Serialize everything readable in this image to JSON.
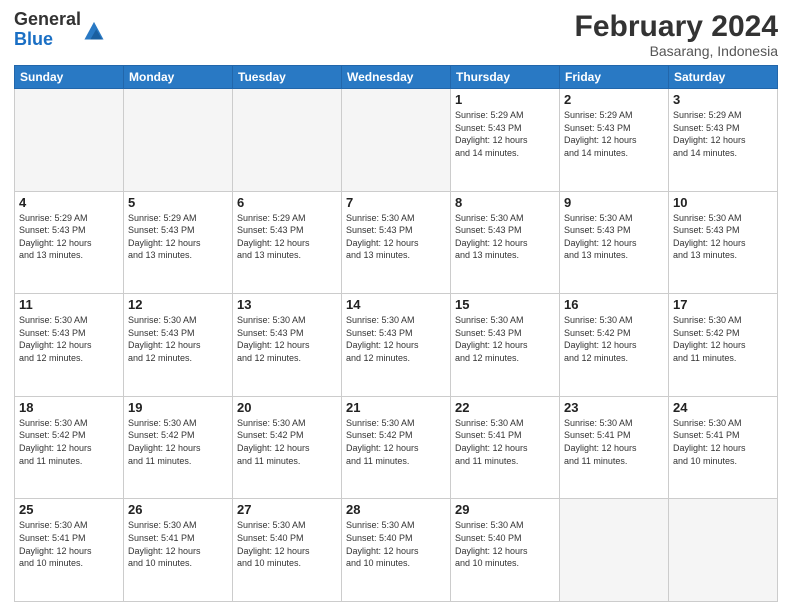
{
  "header": {
    "logo_general": "General",
    "logo_blue": "Blue",
    "month_title": "February 2024",
    "location": "Basarang, Indonesia"
  },
  "weekdays": [
    "Sunday",
    "Monday",
    "Tuesday",
    "Wednesday",
    "Thursday",
    "Friday",
    "Saturday"
  ],
  "weeks": [
    [
      {
        "day": "",
        "info": ""
      },
      {
        "day": "",
        "info": ""
      },
      {
        "day": "",
        "info": ""
      },
      {
        "day": "",
        "info": ""
      },
      {
        "day": "1",
        "info": "Sunrise: 5:29 AM\nSunset: 5:43 PM\nDaylight: 12 hours\nand 14 minutes."
      },
      {
        "day": "2",
        "info": "Sunrise: 5:29 AM\nSunset: 5:43 PM\nDaylight: 12 hours\nand 14 minutes."
      },
      {
        "day": "3",
        "info": "Sunrise: 5:29 AM\nSunset: 5:43 PM\nDaylight: 12 hours\nand 14 minutes."
      }
    ],
    [
      {
        "day": "4",
        "info": "Sunrise: 5:29 AM\nSunset: 5:43 PM\nDaylight: 12 hours\nand 13 minutes."
      },
      {
        "day": "5",
        "info": "Sunrise: 5:29 AM\nSunset: 5:43 PM\nDaylight: 12 hours\nand 13 minutes."
      },
      {
        "day": "6",
        "info": "Sunrise: 5:29 AM\nSunset: 5:43 PM\nDaylight: 12 hours\nand 13 minutes."
      },
      {
        "day": "7",
        "info": "Sunrise: 5:30 AM\nSunset: 5:43 PM\nDaylight: 12 hours\nand 13 minutes."
      },
      {
        "day": "8",
        "info": "Sunrise: 5:30 AM\nSunset: 5:43 PM\nDaylight: 12 hours\nand 13 minutes."
      },
      {
        "day": "9",
        "info": "Sunrise: 5:30 AM\nSunset: 5:43 PM\nDaylight: 12 hours\nand 13 minutes."
      },
      {
        "day": "10",
        "info": "Sunrise: 5:30 AM\nSunset: 5:43 PM\nDaylight: 12 hours\nand 13 minutes."
      }
    ],
    [
      {
        "day": "11",
        "info": "Sunrise: 5:30 AM\nSunset: 5:43 PM\nDaylight: 12 hours\nand 12 minutes."
      },
      {
        "day": "12",
        "info": "Sunrise: 5:30 AM\nSunset: 5:43 PM\nDaylight: 12 hours\nand 12 minutes."
      },
      {
        "day": "13",
        "info": "Sunrise: 5:30 AM\nSunset: 5:43 PM\nDaylight: 12 hours\nand 12 minutes."
      },
      {
        "day": "14",
        "info": "Sunrise: 5:30 AM\nSunset: 5:43 PM\nDaylight: 12 hours\nand 12 minutes."
      },
      {
        "day": "15",
        "info": "Sunrise: 5:30 AM\nSunset: 5:43 PM\nDaylight: 12 hours\nand 12 minutes."
      },
      {
        "day": "16",
        "info": "Sunrise: 5:30 AM\nSunset: 5:42 PM\nDaylight: 12 hours\nand 12 minutes."
      },
      {
        "day": "17",
        "info": "Sunrise: 5:30 AM\nSunset: 5:42 PM\nDaylight: 12 hours\nand 11 minutes."
      }
    ],
    [
      {
        "day": "18",
        "info": "Sunrise: 5:30 AM\nSunset: 5:42 PM\nDaylight: 12 hours\nand 11 minutes."
      },
      {
        "day": "19",
        "info": "Sunrise: 5:30 AM\nSunset: 5:42 PM\nDaylight: 12 hours\nand 11 minutes."
      },
      {
        "day": "20",
        "info": "Sunrise: 5:30 AM\nSunset: 5:42 PM\nDaylight: 12 hours\nand 11 minutes."
      },
      {
        "day": "21",
        "info": "Sunrise: 5:30 AM\nSunset: 5:42 PM\nDaylight: 12 hours\nand 11 minutes."
      },
      {
        "day": "22",
        "info": "Sunrise: 5:30 AM\nSunset: 5:41 PM\nDaylight: 12 hours\nand 11 minutes."
      },
      {
        "day": "23",
        "info": "Sunrise: 5:30 AM\nSunset: 5:41 PM\nDaylight: 12 hours\nand 11 minutes."
      },
      {
        "day": "24",
        "info": "Sunrise: 5:30 AM\nSunset: 5:41 PM\nDaylight: 12 hours\nand 10 minutes."
      }
    ],
    [
      {
        "day": "25",
        "info": "Sunrise: 5:30 AM\nSunset: 5:41 PM\nDaylight: 12 hours\nand 10 minutes."
      },
      {
        "day": "26",
        "info": "Sunrise: 5:30 AM\nSunset: 5:41 PM\nDaylight: 12 hours\nand 10 minutes."
      },
      {
        "day": "27",
        "info": "Sunrise: 5:30 AM\nSunset: 5:40 PM\nDaylight: 12 hours\nand 10 minutes."
      },
      {
        "day": "28",
        "info": "Sunrise: 5:30 AM\nSunset: 5:40 PM\nDaylight: 12 hours\nand 10 minutes."
      },
      {
        "day": "29",
        "info": "Sunrise: 5:30 AM\nSunset: 5:40 PM\nDaylight: 12 hours\nand 10 minutes."
      },
      {
        "day": "",
        "info": ""
      },
      {
        "day": "",
        "info": ""
      }
    ]
  ]
}
